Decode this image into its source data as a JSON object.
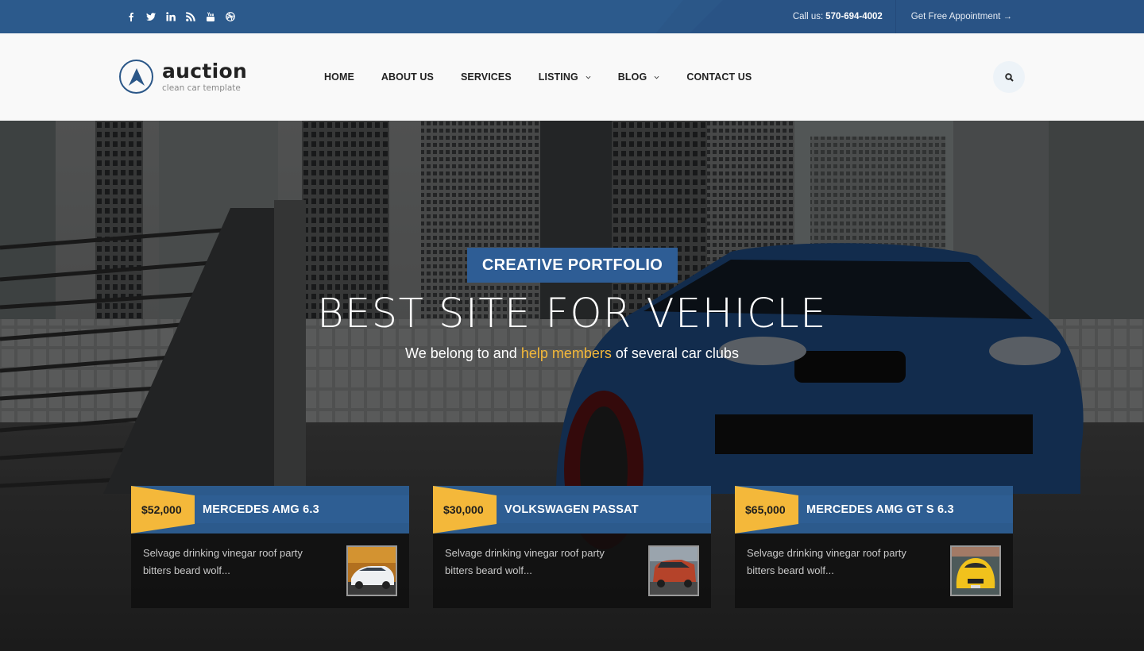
{
  "topbar": {
    "social": [
      {
        "icon": "facebook-icon",
        "label": "f"
      },
      {
        "icon": "twitter-icon",
        "label": "twitter"
      },
      {
        "icon": "linkedin-icon",
        "label": "in"
      },
      {
        "icon": "rss-icon",
        "label": "rss"
      },
      {
        "icon": "youtube-icon",
        "label": "youtube"
      },
      {
        "icon": "dribbble-icon",
        "label": "dribbble"
      }
    ],
    "call_label": "Call us:",
    "phone": "570-694-4002",
    "appointment": "Get Free Appointment →"
  },
  "header": {
    "logo_name": "auction",
    "logo_tagline": "clean car template",
    "nav": [
      {
        "label": "HOME",
        "dropdown": false
      },
      {
        "label": "ABOUT US",
        "dropdown": false
      },
      {
        "label": "SERVICES",
        "dropdown": false
      },
      {
        "label": "LISTING",
        "dropdown": true
      },
      {
        "label": "BLOG",
        "dropdown": true
      },
      {
        "label": "CONTACT US",
        "dropdown": false
      }
    ],
    "search_icon": "search-icon"
  },
  "hero": {
    "badge": "CREATIVE PORTFOLIO",
    "headline": "BEST SITE FOR VEHICLE",
    "sub_before": "We belong to and ",
    "sub_highlight": "help members",
    "sub_after": " of several car clubs"
  },
  "cards": [
    {
      "price": "$52,000",
      "title": "MERCEDES AMG 6.3",
      "desc": "Selvage drinking vinegar roof party bitters beard wolf...",
      "thumb": "white-mercedes-thumbnail"
    },
    {
      "price": "$30,000",
      "title": "VOLKSWAGEN PASSAT",
      "desc": "Selvage drinking vinegar roof party bitters beard wolf...",
      "thumb": "red-volkswagen-thumbnail"
    },
    {
      "price": "$65,000",
      "title": "MERCEDES AMG GT S 6.3",
      "desc": "Selvage drinking vinegar roof party bitters beard wolf...",
      "thumb": "yellow-mercedes-thumbnail"
    }
  ],
  "colors": {
    "brand_blue": "#2b5788",
    "accent_yellow": "#f4b83a",
    "header_bg": "#f9f9f9",
    "text_dark": "#222222"
  }
}
